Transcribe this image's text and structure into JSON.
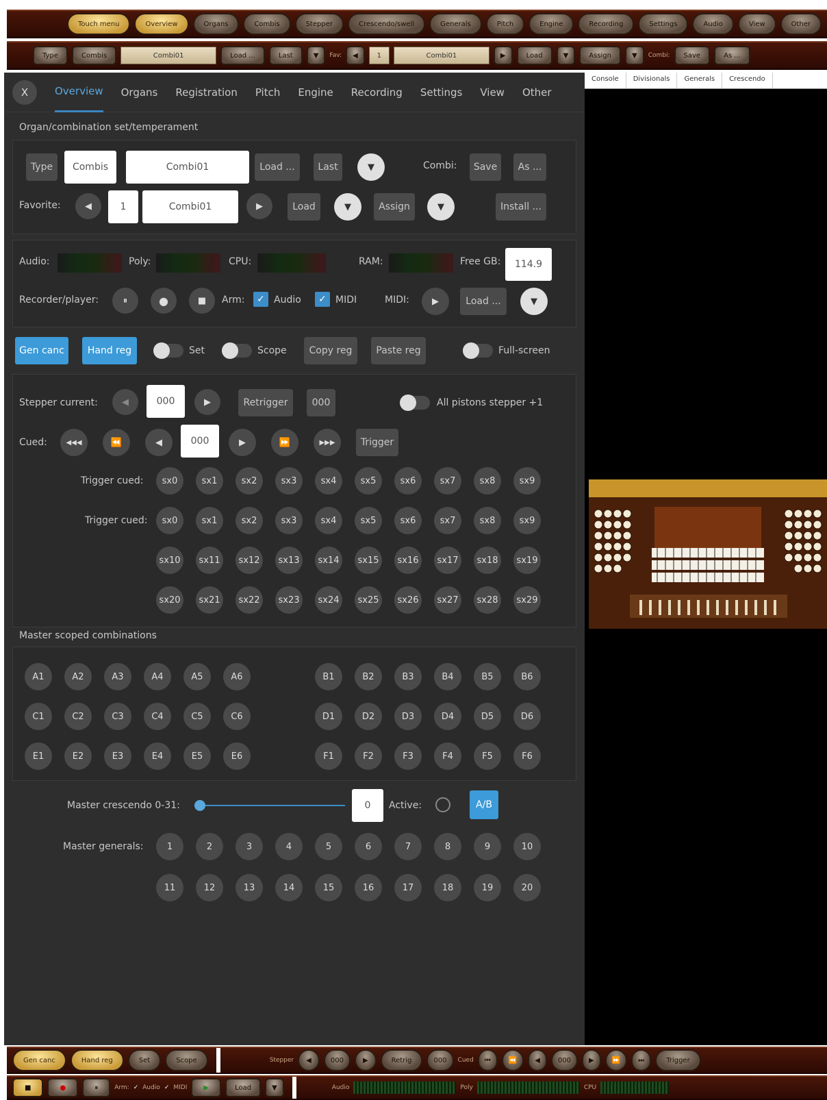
{
  "top_bar": {
    "buttons": [
      "Touch menu",
      "Overview",
      "Organs",
      "Combis",
      "Stepper",
      "Crescendo/swell",
      "Generals",
      "Pitch",
      "Engine",
      "Recording",
      "Settings",
      "Audio",
      "View",
      "Other"
    ]
  },
  "second_bar": {
    "type_label": "Type",
    "combis_label": "Combis",
    "combi_value": "Combi01",
    "load_label": "Load ...",
    "last_label": "Last",
    "fav_label": "Fav:",
    "fav_num": "1",
    "fav_value": "Combi01",
    "load2_label": "Load",
    "assign_label": "Assign",
    "combi_label": "Combi:",
    "save_label": "Save",
    "as_label": "As ..."
  },
  "tabs": [
    "Overview",
    "Organs",
    "Registration",
    "Pitch",
    "Engine",
    "Recording",
    "Settings",
    "View",
    "Other"
  ],
  "close_label": "X",
  "section1": {
    "title": "Organ/combination set/temperament",
    "type": "Type",
    "combis": "Combis",
    "combi_name": "Combi01",
    "load": "Load ...",
    "last": "Last",
    "combi_label": "Combi:",
    "save": "Save",
    "as": "As ...",
    "favorite_label": "Favorite:",
    "fav_num": "1",
    "fav_name": "Combi01",
    "load_short": "Load",
    "assign": "Assign",
    "install": "Install ..."
  },
  "section2": {
    "audio": "Audio:",
    "poly": "Poly:",
    "cpu": "CPU:",
    "ram": "RAM:",
    "free_gb_label": "Free GB:",
    "free_gb": "114.9",
    "recorder": "Recorder/player:",
    "arm": "Arm:",
    "audio_check": "Audio",
    "midi_check": "MIDI",
    "midi_label": "MIDI:",
    "load": "Load ..."
  },
  "row3": {
    "gen_canc": "Gen canc",
    "hand_reg": "Hand reg",
    "set": "Set",
    "scope": "Scope",
    "copy_reg": "Copy reg",
    "paste_reg": "Paste reg",
    "fullscreen": "Full-screen"
  },
  "stepper": {
    "current_label": "Stepper current:",
    "current": "000",
    "retrigger": "Retrigger",
    "retrig_val": "000",
    "all_pistons": "All pistons stepper +1",
    "cued_label": "Cued:",
    "cued": "000",
    "trigger": "Trigger",
    "trigger_cued1": "Trigger cued:",
    "trigger_cued2": "Trigger cued:",
    "row1": [
      "sx0",
      "sx1",
      "sx2",
      "sx3",
      "sx4",
      "sx5",
      "sx6",
      "sx7",
      "sx8",
      "sx9"
    ],
    "row2": [
      "sx0",
      "sx1",
      "sx2",
      "sx3",
      "sx4",
      "sx5",
      "sx6",
      "sx7",
      "sx8",
      "sx9"
    ],
    "row3": [
      "sx10",
      "sx11",
      "sx12",
      "sx13",
      "sx14",
      "sx15",
      "sx16",
      "sx17",
      "sx18",
      "sx19"
    ],
    "row4": [
      "sx20",
      "sx21",
      "sx22",
      "sx23",
      "sx24",
      "sx25",
      "sx26",
      "sx27",
      "sx28",
      "sx29"
    ]
  },
  "master_scoped": {
    "title": "Master scoped combinations",
    "left": [
      [
        "A1",
        "A2",
        "A3",
        "A4",
        "A5",
        "A6"
      ],
      [
        "C1",
        "C2",
        "C3",
        "C4",
        "C5",
        "C6"
      ],
      [
        "E1",
        "E2",
        "E3",
        "E4",
        "E5",
        "E6"
      ]
    ],
    "right": [
      [
        "B1",
        "B2",
        "B3",
        "B4",
        "B5",
        "B6"
      ],
      [
        "D1",
        "D2",
        "D3",
        "D4",
        "D5",
        "D6"
      ],
      [
        "F1",
        "F2",
        "F3",
        "F4",
        "F5",
        "F6"
      ]
    ]
  },
  "crescendo": {
    "label": "Master crescendo 0-31:",
    "value": "0",
    "slider_fraction": 0,
    "active": "Active:",
    "ab": "A/B"
  },
  "generals": {
    "label": "Master generals:",
    "row1": [
      "1",
      "2",
      "3",
      "4",
      "5",
      "6",
      "7",
      "8",
      "9",
      "10"
    ],
    "row2": [
      "11",
      "12",
      "13",
      "14",
      "15",
      "16",
      "17",
      "18",
      "19",
      "20"
    ]
  },
  "right_tabs": [
    "Console",
    "Divisionals",
    "Generals",
    "Crescendo"
  ],
  "bottom1": {
    "gen_canc": "Gen canc",
    "hand_reg": "Hand reg",
    "set": "Set",
    "scope": "Scope",
    "stepper": "Stepper",
    "stepper_val": "000",
    "retrig": "Retrig",
    "retrig_val": "000",
    "cued_label": "Cued",
    "cued_val": "000",
    "trigger": "Trigger"
  },
  "bottom2": {
    "arm": "Arm:",
    "audio": "Audio",
    "midi": "MIDI",
    "load": "Load",
    "audio_meter": "Audio",
    "poly_meter": "Poly",
    "cpu_meter": "CPU"
  },
  "colors": {
    "accent": "#3c9bd8",
    "panel": "#2e2e2e",
    "toolbar": "#3a0e04",
    "gold": "#e8c670"
  }
}
